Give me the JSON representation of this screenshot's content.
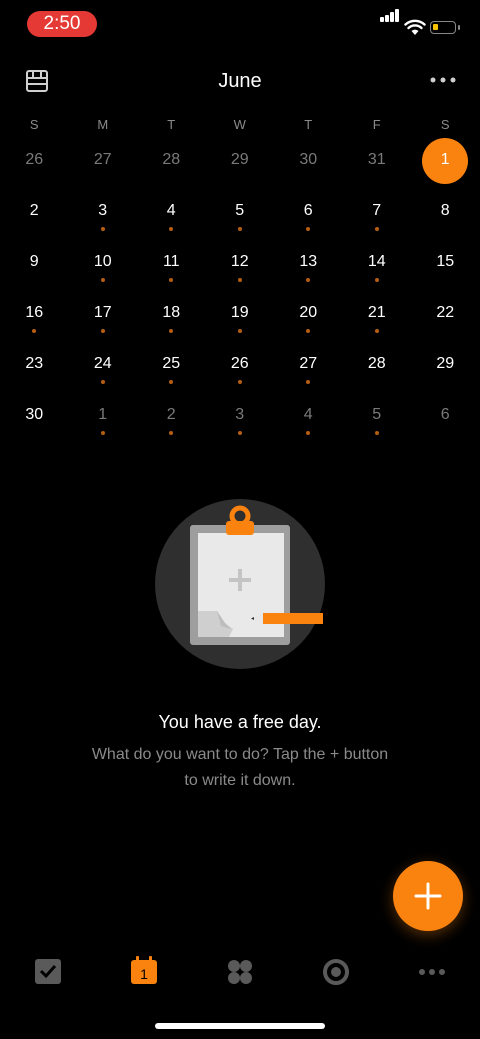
{
  "status_bar": {
    "time": "2:50"
  },
  "header": {
    "month": "June"
  },
  "weekdays": [
    "S",
    "M",
    "T",
    "W",
    "T",
    "F",
    "S"
  ],
  "weeks": [
    [
      {
        "d": "26",
        "muted": true
      },
      {
        "d": "27",
        "muted": true
      },
      {
        "d": "28",
        "muted": true
      },
      {
        "d": "29",
        "muted": true
      },
      {
        "d": "30",
        "muted": true
      },
      {
        "d": "31",
        "muted": true
      },
      {
        "d": "1",
        "selected": true
      }
    ],
    [
      {
        "d": "2"
      },
      {
        "d": "3",
        "dot": true
      },
      {
        "d": "4",
        "dot": true
      },
      {
        "d": "5",
        "dot": true
      },
      {
        "d": "6",
        "dot": true
      },
      {
        "d": "7",
        "dot": true
      },
      {
        "d": "8"
      }
    ],
    [
      {
        "d": "9"
      },
      {
        "d": "10",
        "dot": true
      },
      {
        "d": "11",
        "dot": true
      },
      {
        "d": "12",
        "dot": true
      },
      {
        "d": "13",
        "dot": true
      },
      {
        "d": "14",
        "dot": true
      },
      {
        "d": "15"
      }
    ],
    [
      {
        "d": "16",
        "dot": true
      },
      {
        "d": "17",
        "dot": true
      },
      {
        "d": "18",
        "dot": true
      },
      {
        "d": "19",
        "dot": true
      },
      {
        "d": "20",
        "dot": true
      },
      {
        "d": "21",
        "dot": true
      },
      {
        "d": "22"
      }
    ],
    [
      {
        "d": "23"
      },
      {
        "d": "24",
        "dot": true
      },
      {
        "d": "25",
        "dot": true
      },
      {
        "d": "26",
        "dot": true
      },
      {
        "d": "27",
        "dot": true
      },
      {
        "d": "28"
      },
      {
        "d": "29"
      }
    ],
    [
      {
        "d": "30"
      },
      {
        "d": "1",
        "muted": true,
        "dot": true
      },
      {
        "d": "2",
        "muted": true,
        "dot": true
      },
      {
        "d": "3",
        "muted": true,
        "dot": true
      },
      {
        "d": "4",
        "muted": true,
        "dot": true
      },
      {
        "d": "5",
        "muted": true,
        "dot": true
      },
      {
        "d": "6",
        "muted": true
      }
    ]
  ],
  "empty_state": {
    "title": "You have a free day.",
    "subtitle_line1": "What do you want to do? Tap the + button",
    "subtitle_line2": "to write it down."
  },
  "bottom_nav": {
    "items": [
      {
        "icon": "checkbox-icon"
      },
      {
        "icon": "calendar-icon",
        "badge": "1",
        "active": true
      },
      {
        "icon": "grid-icon"
      },
      {
        "icon": "focus-icon"
      },
      {
        "icon": "more-icon"
      }
    ]
  },
  "colors": {
    "accent": "#f9830e",
    "background": "#000000",
    "muted_text": "#7a7a7a"
  }
}
